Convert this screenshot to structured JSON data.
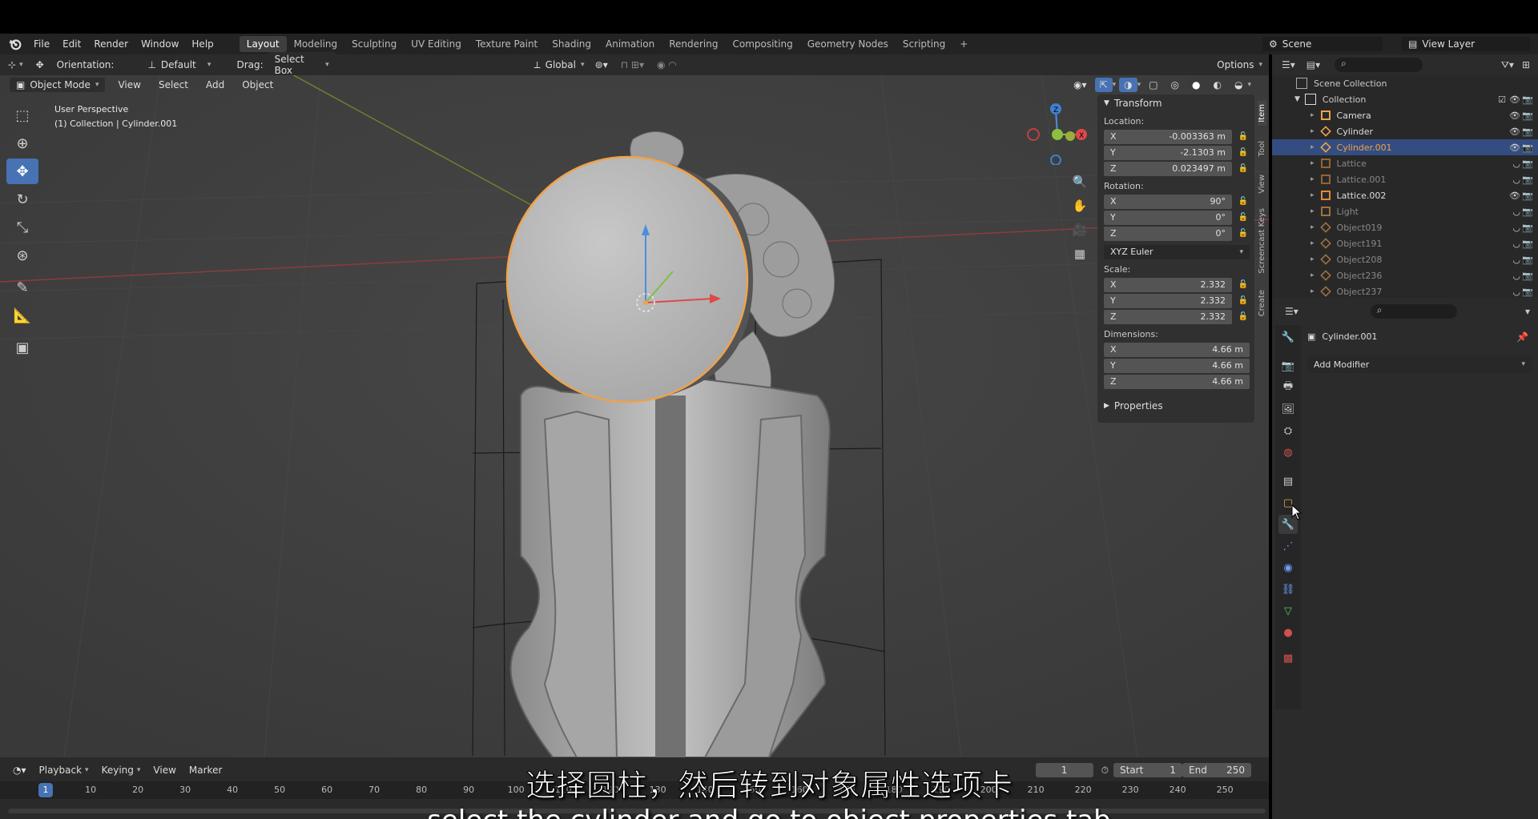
{
  "menu": [
    "File",
    "Edit",
    "Render",
    "Window",
    "Help"
  ],
  "workspaces": [
    "Layout",
    "Modeling",
    "Sculpting",
    "UV Editing",
    "Texture Paint",
    "Shading",
    "Animation",
    "Rendering",
    "Compositing",
    "Geometry Nodes",
    "Scripting"
  ],
  "active_workspace": "Layout",
  "scene": {
    "label": "Scene",
    "view_layer": "View Layer"
  },
  "header": {
    "orientation_label": "Orientation:",
    "orientation_value": "Default",
    "drag_label": "Drag:",
    "drag_value": "Select Box",
    "transform_space": "Global",
    "options": "Options"
  },
  "viewport_menu": {
    "mode": "Object Mode",
    "items": [
      "View",
      "Select",
      "Add",
      "Object"
    ]
  },
  "viewport_info": {
    "line1": "User Perspective",
    "line2": "(1) Collection | Cylinder.001"
  },
  "npanel": {
    "transform_title": "Transform",
    "location_label": "Location:",
    "location": [
      {
        "axis": "X",
        "value": "-0.003363 m"
      },
      {
        "axis": "Y",
        "value": "-2.1303 m"
      },
      {
        "axis": "Z",
        "value": "0.023497 m"
      }
    ],
    "rotation_label": "Rotation:",
    "rotation": [
      {
        "axis": "X",
        "value": "90°"
      },
      {
        "axis": "Y",
        "value": "0°"
      },
      {
        "axis": "Z",
        "value": "0°"
      }
    ],
    "rotation_mode": "XYZ Euler",
    "scale_label": "Scale:",
    "scale": [
      {
        "axis": "X",
        "value": "2.332"
      },
      {
        "axis": "Y",
        "value": "2.332"
      },
      {
        "axis": "Z",
        "value": "2.332"
      }
    ],
    "dimensions_label": "Dimensions:",
    "dimensions": [
      {
        "axis": "X",
        "value": "4.66 m"
      },
      {
        "axis": "Y",
        "value": "4.66 m"
      },
      {
        "axis": "Z",
        "value": "4.66 m"
      }
    ],
    "properties_title": "Properties"
  },
  "side_tabs": [
    "Item",
    "Tool",
    "View",
    "Screencast Keys",
    "Create"
  ],
  "outliner": {
    "root": "Scene Collection",
    "collection": "Collection",
    "items": [
      {
        "name": "Camera",
        "type": "camera",
        "dim": false,
        "selected": false
      },
      {
        "name": "Cylinder",
        "type": "mesh",
        "dim": false,
        "selected": false
      },
      {
        "name": "Cylinder.001",
        "type": "mesh",
        "dim": false,
        "selected": true
      },
      {
        "name": "Lattice",
        "type": "lattice",
        "dim": true,
        "selected": false
      },
      {
        "name": "Lattice.001",
        "type": "lattice",
        "dim": true,
        "selected": false
      },
      {
        "name": "Lattice.002",
        "type": "lattice",
        "dim": false,
        "selected": false
      },
      {
        "name": "Light",
        "type": "light",
        "dim": true,
        "selected": false
      },
      {
        "name": "Object019",
        "type": "mesh",
        "dim": true,
        "selected": false
      },
      {
        "name": "Object191",
        "type": "mesh",
        "dim": true,
        "selected": false
      },
      {
        "name": "Object208",
        "type": "mesh",
        "dim": true,
        "selected": false
      },
      {
        "name": "Object236",
        "type": "mesh",
        "dim": true,
        "selected": false
      },
      {
        "name": "Object237",
        "type": "mesh",
        "dim": true,
        "selected": false
      }
    ]
  },
  "properties": {
    "object_name": "Cylinder.001",
    "add_modifier": "Add Modifier"
  },
  "timeline": {
    "menu": [
      "Playback",
      "Keying",
      "View",
      "Marker"
    ],
    "current_frame": "1",
    "start_label": "Start",
    "start": "1",
    "end_label": "End",
    "end": "250",
    "ticks": [
      "1",
      "10",
      "20",
      "30",
      "40",
      "50",
      "60",
      "70",
      "80",
      "90",
      "100",
      "110",
      "120",
      "130",
      "140",
      "150",
      "160",
      "170",
      "180",
      "190",
      "200",
      "210",
      "220",
      "230",
      "240",
      "250"
    ]
  },
  "subtitle": {
    "zh": "选择圆柱，然后转到对象属性选项卡",
    "en": "select the cylinder and go to object properties tab"
  },
  "colors": {
    "accent": "#4772b3",
    "selection_outline": "#f5a14a",
    "outliner_selected": "#334d80",
    "subtitle": "#ffffff"
  }
}
